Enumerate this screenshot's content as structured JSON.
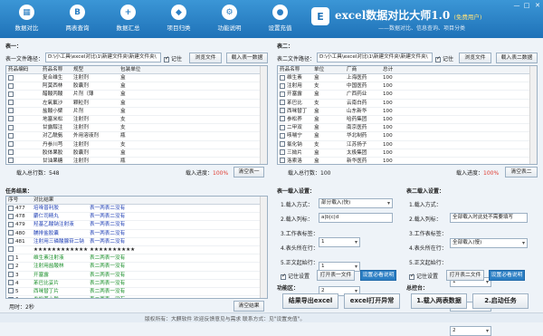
{
  "toolbar": {
    "buttons": [
      {
        "label": "数据对比",
        "icon": "chart-icon",
        "glyph": "▦"
      },
      {
        "label": "两表查询",
        "icon": "b-letter-icon",
        "glyph": "B"
      },
      {
        "label": "数据汇总",
        "icon": "plus-icon",
        "glyph": "+"
      },
      {
        "label": "项目归类",
        "icon": "tag-icon",
        "glyph": "◆"
      },
      {
        "label": "功能说明",
        "icon": "settings-icon",
        "glyph": "⚙"
      },
      {
        "label": "设置充值",
        "icon": "user-icon",
        "glyph": "●"
      }
    ]
  },
  "brand": {
    "title": "excel数据对比大师1.0",
    "edition": "(免费用户)",
    "slogan": "——数据对比、信息查询、项目分类",
    "logo_glyph": "E"
  },
  "window": {
    "min": "—",
    "max": "□",
    "close": "✕"
  },
  "table1": {
    "section_label": "表一：",
    "path_label": "表一文件路径：",
    "path_value": "D:\\小工具\\excel对比\\1\\新建文件夹\\新建文件夹\\",
    "remember_label": "记住",
    "remember_checked": true,
    "browse_label": "浏览文件",
    "load_label": "载入表一数据",
    "headers": [
      "药品编码",
      "药品名称",
      "规型",
      "包装单位"
    ],
    "rows": [
      [
        "",
        "复合维生",
        "注射剂",
        "盒"
      ],
      [
        "",
        "阿莫西林",
        "胶囊剂",
        "盒"
      ],
      [
        "",
        "醋酸丙酸",
        "片剂（薄",
        "盒"
      ],
      [
        "",
        "左氧氟沙",
        "颗粒剂",
        "盒"
      ],
      [
        "",
        "盐酸小檗",
        "片剂",
        "盒"
      ],
      [
        "",
        "地塞米松",
        "注射剂",
        "支"
      ],
      [
        "",
        "甘露醇注",
        "注射剂",
        "支"
      ],
      [
        "",
        "对乙酰氨",
        "外用溶液剂",
        "瓶"
      ],
      [
        "",
        "丹参川芎",
        "注射剂",
        "支"
      ],
      [
        "",
        "胶体果胶",
        "胶囊剂",
        "盒"
      ],
      [
        "",
        "甘油果糖",
        "注射剂",
        "瓶"
      ],
      [
        "",
        "维生素B",
        "口服液",
        "盒"
      ],
      [
        "",
        "安神补脑",
        "口服液",
        "盒"
      ],
      [
        "",
        "布洛芬缓",
        "颗粒剂",
        "盒"
      ]
    ],
    "count_label": "载入总行数：548",
    "progress_label": "载入进度：",
    "progress_value": "100%",
    "clear_label": "清空表一"
  },
  "table2": {
    "section_label": "表二：",
    "path_label": "表二文件路径：",
    "path_value": "D:\\小工具\\excel对比\\1\\新建文件夹\\新建文件夹\\",
    "remember_label": "记住",
    "remember_checked": true,
    "browse_label": "浏览文件",
    "load_label": "载入表二数据",
    "headers": [
      "药品名称",
      "单位",
      "厂商",
      "总计"
    ],
    "rows": [
      [
        "维生素",
        "盒",
        "上海医药",
        "100"
      ],
      [
        "注射用",
        "支",
        "中国医药",
        "100"
      ],
      [
        "开塞露",
        "盒",
        "广西药业",
        "100"
      ],
      [
        "苯巴比",
        "支",
        "云南白药",
        "100"
      ],
      [
        "西咪替丁",
        "盒",
        "山东新华",
        "100"
      ],
      [
        "参松养",
        "盒",
        "哈药集团",
        "100"
      ],
      [
        "二甲双",
        "盒",
        "南京医药",
        "100"
      ],
      [
        "咳喘宁",
        "盒",
        "华北制药",
        "100"
      ],
      [
        "氯化钠",
        "支",
        "江苏扬子",
        "100"
      ],
      [
        "三拗片",
        "盒",
        "太极集团",
        "100"
      ],
      [
        "洛索洛",
        "盒",
        "新华医药",
        "100"
      ],
      [
        "对乙酰",
        "盒",
        "东北制药",
        "100"
      ],
      [
        "胶囊剂",
        "盒",
        "南京医药",
        "100"
      ],
      [
        "阿奇霉",
        "盒",
        "广州白云",
        "100"
      ]
    ],
    "count_label": "载入总行数：100",
    "progress_label": "载入进度：",
    "progress_value": "100%",
    "clear_label": "清空表二"
  },
  "results": {
    "section_label": "任务结果：",
    "headers": [
      "序号",
      "对比结果"
    ],
    "rows": [
      [
        "477",
        "培哚普利胶",
        "表一两表二没有",
        "blue"
      ],
      [
        "478",
        "麝仁司精丸",
        "表一两表二没有",
        "blue"
      ],
      [
        "479",
        "羟基乙酸钠注射液",
        "表一两表二没有",
        "blue"
      ],
      [
        "480",
        "脯排盐胶囊",
        "表一两表二没有",
        "blue"
      ],
      [
        "481",
        "注射用三磷酸腺苷二钠",
        "表一两表二没有",
        "blue"
      ],
      [
        "",
        "★★★★★★★★★★★★★",
        "★★★★★★★★★★",
        "black"
      ],
      [
        "1",
        "维生素注射液",
        "表二两表一没有",
        "green"
      ],
      [
        "2",
        "注射用盐酸林",
        "表二两表一没有",
        "green"
      ],
      [
        "3",
        "开塞露",
        "表二两表一没有",
        "green"
      ],
      [
        "4",
        "苯巴比妥片",
        "表二两表一没有",
        "green"
      ],
      [
        "5",
        "西咪替丁片",
        "表二两表一没有",
        "green"
      ],
      [
        "6",
        "参松养心胶",
        "表二两表一没有",
        "green"
      ]
    ],
    "time_label": "用时：2秒",
    "clear_label": "清空结果"
  },
  "table1_settings": {
    "section_label": "表一载入设置：",
    "mode_label": "1.载入方式：",
    "mode_value": "部分载入(快)",
    "cols_label": "2.载入列标：",
    "cols_value": "a|b|c|d",
    "sheet_label": "3.工作表标签：",
    "sheet_value": "1",
    "start_label": "4.表头所在行：",
    "start_value": "1",
    "text_label": "5.正文起始行：",
    "text_value": "2",
    "remember_label": "记住设置",
    "remember_checked": true,
    "open_label": "打开表一文件",
    "help_label": "设置必看说明"
  },
  "table2_settings": {
    "section_label": "表二载入设置：",
    "mode_label": "1.载入方式：",
    "mode_value": "全部载入(慢)",
    "cols_label": "2.载入列标：",
    "cols_value": "全部载入时此处不需要填写",
    "sheet_label": "3.工作表标签：",
    "sheet_value": "1",
    "start_label": "4.表头所在行：",
    "start_value": "1",
    "text_label": "5.正文起始行：",
    "text_value": "2",
    "remember_label": "记住设置",
    "remember_checked": true,
    "open_label": "打开表二文件",
    "help_label": "设置必看说明"
  },
  "functions": {
    "section_label": "功能区：",
    "export_label": "结果导出excel",
    "open_label": "excel打开异常"
  },
  "control": {
    "section_label": "总控台：",
    "load_label": "1.载入两表数据",
    "start_label": "2.启动任务"
  },
  "status": {
    "text": "版权所有：大麒软件    欢迎反馈意见与需求  联系方式：见\"设置充值\"。"
  }
}
